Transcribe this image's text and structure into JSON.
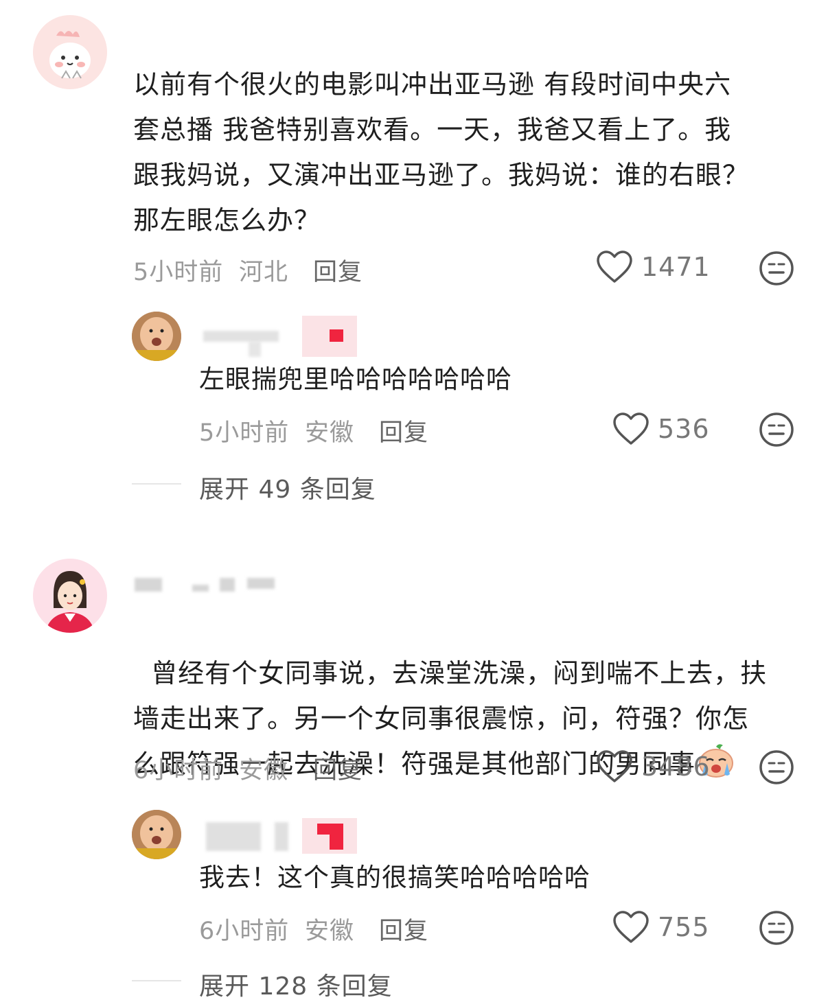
{
  "comments": [
    {
      "text": "以前有个很火的电影叫冲出亚马逊 有段时间中央六\n套总播 我爸特别喜欢看。一天，我爸又看上了。我\n跟我妈说，又演冲出亚马逊了。我妈说：谁的右眼？\n那左眼怎么办？",
      "time": "5小时前",
      "location": "河北",
      "reply_label": "回复",
      "likes": "1471",
      "reply": {
        "text": "左眼揣兜里哈哈哈哈哈哈哈",
        "time": "5小时前",
        "location": "安徽",
        "reply_label": "回复",
        "likes": "536"
      },
      "expand_label": "展开 49 条回复"
    },
    {
      "text": "曾经有个女同事说，去澡堂洗澡，闷到喘不上去，扶\n墙走出来了。另一个女同事很震惊，问，符强？你怎\n么跟符强一起去洗澡！符强是其他部门的男同事",
      "time": "6小时前",
      "location": "安徽",
      "reply_label": "回复",
      "likes": "3486",
      "reply": {
        "text": "我去！这个真的很搞笑哈哈哈哈哈",
        "time": "6小时前",
        "location": "安徽",
        "reply_label": "回复",
        "likes": "755"
      },
      "expand_label": "展开 128 条回复"
    }
  ],
  "colors": {
    "badge_red": "#f0243f",
    "meta_gray": "#9a9a9a",
    "text_dark": "#1f1f1f"
  },
  "icons": [
    "heart-outline-icon",
    "meh-face-icon",
    "crying-emoji-icon"
  ]
}
